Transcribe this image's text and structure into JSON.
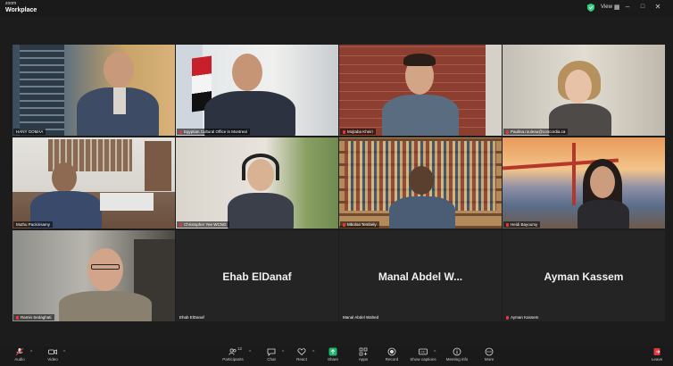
{
  "app": {
    "brand_small": "zoom",
    "brand_name": "Workplace"
  },
  "titlebar": {
    "view_label": "View"
  },
  "colors": {
    "active_speaker": "#35d07f",
    "muted": "#e0393e",
    "share": "#1fb66f",
    "leave": "#e0393e"
  },
  "participants": [
    {
      "name": "HANY GOMAA",
      "video": true,
      "muted": false,
      "active": true
    },
    {
      "name": "Egyptian Cultural Office in Montreal",
      "video": true,
      "muted": true,
      "active": false
    },
    {
      "name": "Mojtaba Kheiri",
      "video": true,
      "muted": true,
      "active": false
    },
    {
      "name": "Paulina.rouleau@concordia.ca",
      "video": true,
      "muted": true,
      "active": false
    },
    {
      "name": "Muthu Packirisamy",
      "video": true,
      "muted": false,
      "active": false
    },
    {
      "name": "Christopher Yee WCNG",
      "video": true,
      "muted": true,
      "active": false
    },
    {
      "name": "Mboloa Tembely",
      "video": true,
      "muted": true,
      "active": false
    },
    {
      "name": "Heidi Bayoumy",
      "video": true,
      "muted": true,
      "active": false
    },
    {
      "name": "Ramin Sedaghati",
      "video": true,
      "muted": true,
      "active": false
    },
    {
      "name": "Ehab ElDanaf",
      "display": "Ehab ElDanaf",
      "video": false,
      "muted": false,
      "active": false
    },
    {
      "name": "Manal Abdel Wahed",
      "display": "Manal Abdel W...",
      "video": false,
      "muted": false,
      "active": false
    },
    {
      "name": "Ayman Kassem",
      "display": "Ayman Kassem",
      "video": false,
      "muted": true,
      "active": false
    }
  ],
  "toolbar": {
    "audio": "Audio",
    "video": "Video",
    "participants": "Participants",
    "participants_count": "12",
    "chat": "Chat",
    "react": "React",
    "share": "Share",
    "apps": "Apps",
    "record": "Record",
    "show_captions": "Show captions",
    "meeting_info": "Meeting info",
    "more": "More",
    "leave": "Leave"
  }
}
